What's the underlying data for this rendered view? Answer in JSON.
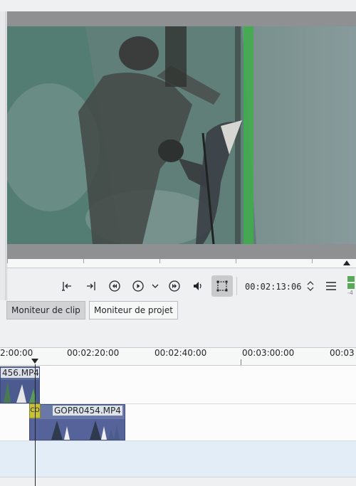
{
  "monitor": {
    "timecode": "00:02:13:06",
    "buttons": [
      {
        "name": "set-zone-in-button",
        "icon": "zone-in-icon"
      },
      {
        "name": "set-zone-out-button",
        "icon": "zone-out-icon"
      },
      {
        "name": "rewind-button",
        "icon": "rewind-icon"
      },
      {
        "name": "play-button",
        "icon": "play-icon"
      },
      {
        "name": "play-options-button",
        "icon": "chevron-down-icon"
      },
      {
        "name": "forward-button",
        "icon": "fast-forward-icon"
      },
      {
        "name": "volume-button",
        "icon": "speaker-icon"
      },
      {
        "name": "safe-zone-button",
        "icon": "crop-frame-icon"
      },
      {
        "name": "monitor-menu-button",
        "icon": "hamburger-menu-icon"
      }
    ],
    "level_meter_label": "-4"
  },
  "tabs": [
    {
      "label": "Moniteur de clip",
      "active": true
    },
    {
      "label": "Moniteur de projet",
      "active": false
    }
  ],
  "timeline": {
    "ruler_labels": [
      "2:00:00",
      "00:02:20:00",
      "00:02:40:00",
      "00:03:00:00",
      "00:03"
    ],
    "clips": [
      {
        "label": "456.MP4",
        "track": 1
      },
      {
        "label": "GOPR0454.MP4",
        "track": 2
      }
    ],
    "composition_label": "CO"
  },
  "colors": {
    "accent": "#3daee9",
    "clip_bg": "#5f6a9e",
    "composition": "#c8c23a",
    "audio_level": "#5ba85a"
  }
}
